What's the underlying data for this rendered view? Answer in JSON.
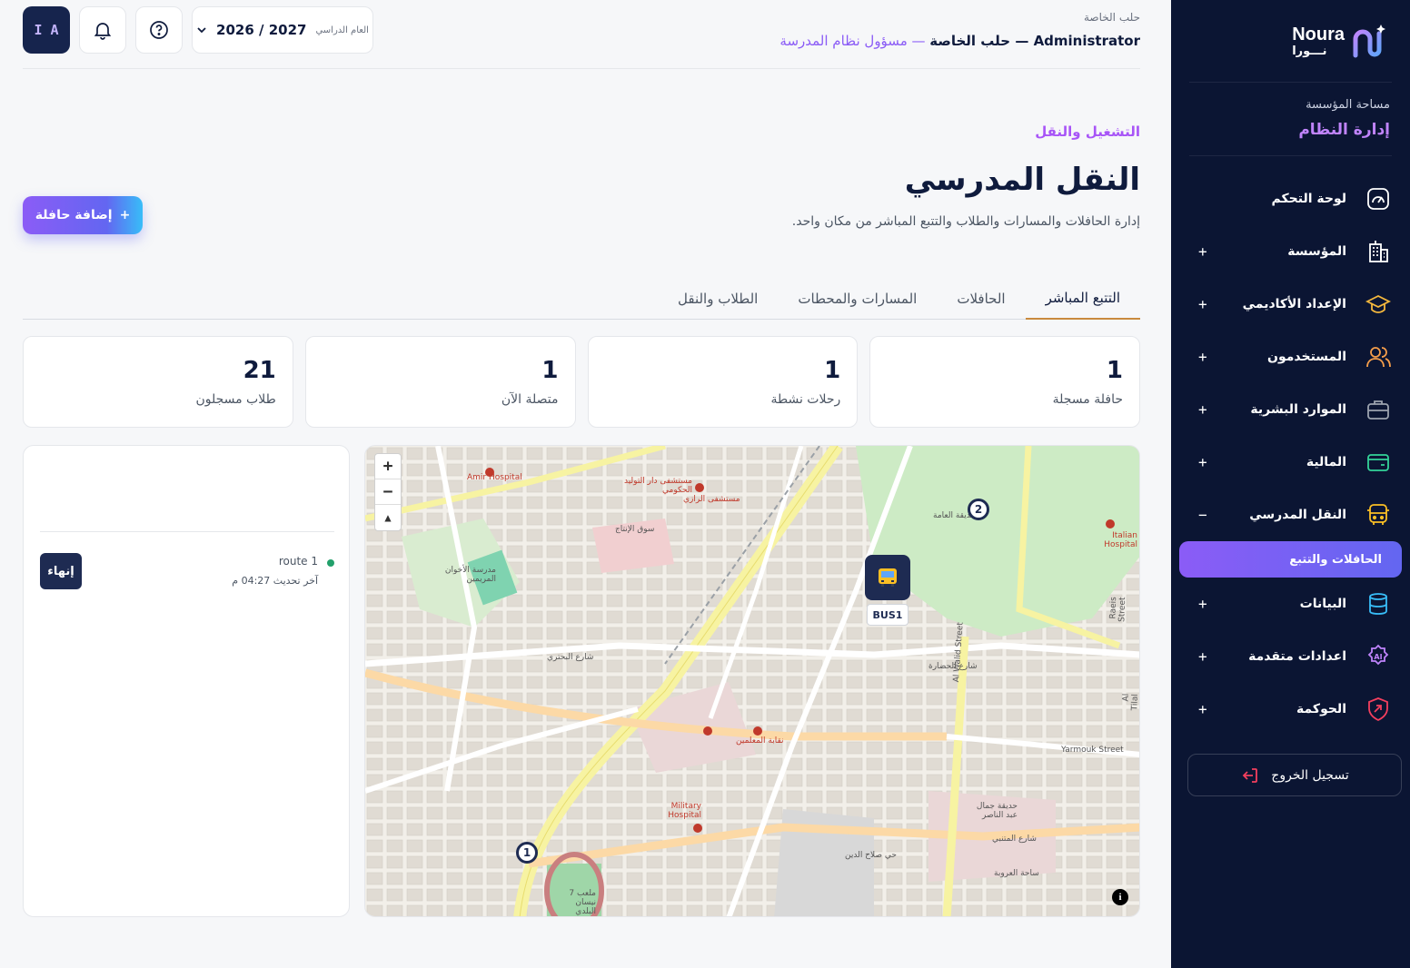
{
  "sidebar": {
    "brand_en": "Noura",
    "brand_ar": "نـــورا",
    "workspace_label": "مساحة المؤسسة",
    "workspace_value": "إدارة النظام",
    "items": [
      {
        "label": "لوحة التحكم",
        "icon": "dashboard-icon",
        "toggle": ""
      },
      {
        "label": "المؤسسة",
        "icon": "building-icon",
        "toggle": "+"
      },
      {
        "label": "الإعداد الأكاديمي",
        "icon": "graduation-cap-icon",
        "toggle": "+"
      },
      {
        "label": "المستخدمون",
        "icon": "users-icon",
        "toggle": "+"
      },
      {
        "label": "الموارد البشرية",
        "icon": "briefcase-icon",
        "toggle": "+"
      },
      {
        "label": "المالية",
        "icon": "wallet-icon",
        "toggle": "+"
      },
      {
        "label": "النقل المدرسي",
        "icon": "bus-icon",
        "toggle": "−"
      },
      {
        "label": "البيانات",
        "icon": "database-icon",
        "toggle": "+"
      },
      {
        "label": "اعدادات متقدمة",
        "icon": "ai-badge-icon",
        "toggle": "+"
      },
      {
        "label": "الحوكمة",
        "icon": "shield-icon",
        "toggle": "+"
      }
    ],
    "sub_item_active": "الحافلات والتتبع",
    "logout_label": "تسجيل الخروج"
  },
  "topbar": {
    "school_small": "حلب الخاصة",
    "role_main": "Administrator — حلب الخاصة",
    "role_extra": " — مسؤول نظام المدرسة",
    "avatar_initials": "I A",
    "year_label": "العام الدراسي",
    "year_value": "2026 / 2027"
  },
  "page": {
    "breadcrumb": "التشغيل والنقل",
    "title": "النقل المدرسي",
    "subtitle": "إدارة الحافلات والمسارات والطلاب والتتبع المباشر من مكان واحد.",
    "add_button": "إضافة حافلة",
    "add_icon": "+"
  },
  "tabs": [
    {
      "label": "التتبع المباشر",
      "active": true
    },
    {
      "label": "الحافلات",
      "active": false
    },
    {
      "label": "المسارات والمحطات",
      "active": false
    },
    {
      "label": "الطلاب والنقل",
      "active": false
    }
  ],
  "stats": [
    {
      "value": "1",
      "label": "حافلة مسجلة"
    },
    {
      "value": "1",
      "label": "رحلات نشطة"
    },
    {
      "value": "1",
      "label": "متصلة الآن"
    },
    {
      "value": "21",
      "label": "طلاب مسجلون"
    }
  ],
  "map": {
    "bus_label": "BUS1",
    "stop_1": "1",
    "stop_2": "2",
    "zoom_in": "+",
    "zoom_out": "−",
    "reset": "▲",
    "info": "i",
    "labels": [
      "Amir Hospital",
      "مستشفى دار التوليد الحكومي",
      "مستشفى الرازي",
      "مدرسة الأخوان المريمين",
      "سوق الإنتاج",
      "الحديقة العامة",
      "Italian Hospital",
      "Military Hospital",
      "شارع البحتري",
      "شارع الحضارة",
      "Al Walid Street",
      "شارع المتنبي",
      "Yarmouk Street",
      "ملعب 7 نيسان البلدي",
      "نقابة المعلمين",
      "Raeis Street",
      "Al Tilal Street",
      "حديقة جمال عبد الناصر",
      "ساحة العروبة",
      "حي صلاح الدين"
    ]
  },
  "trips": {
    "route_name": "route 1",
    "last_update": "آخر تحديث 04:27 م",
    "end_button": "إنهاء"
  },
  "colors": {
    "sidebar_bg": "#0b1533",
    "accent_purple": "#8b5cf6",
    "accent_indigo": "#6366f1",
    "tab_active_underline": "#c98a3e",
    "status_online": "#22a06b",
    "navy": "#1e2b52"
  }
}
